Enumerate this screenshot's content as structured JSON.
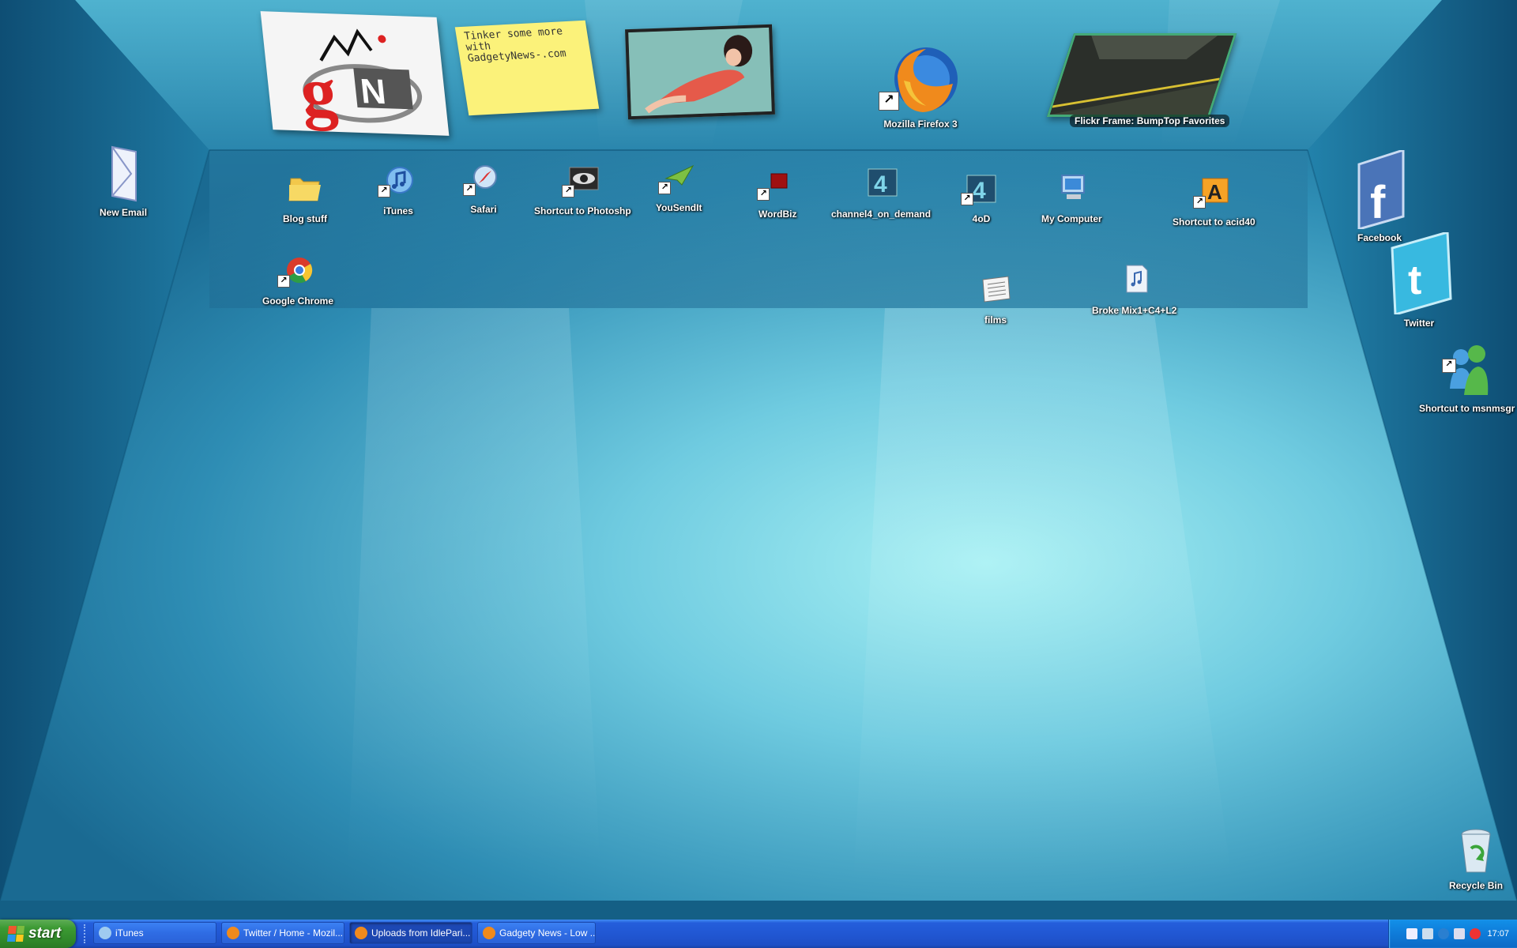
{
  "wall_items": {
    "sticky_note": "Tinker some more with GadgetyNews-.com",
    "firefox_label": "Mozilla Firefox 3",
    "flickr_label": "Flickr Frame: BumpTop Favorites"
  },
  "desktop_icons": {
    "new_email": "New Email",
    "blog_stuff": "Blog stuff",
    "itunes": "iTunes",
    "safari": "Safari",
    "photoshop": "Shortcut to Photoshp",
    "yousendit": "YouSendIt",
    "wordbiz": "WordBiz",
    "channel4": "channel4_on_demand",
    "fourod": "4oD",
    "my_computer": "My Computer",
    "acid40": "Shortcut to acid40",
    "google_chrome": "Google Chrome",
    "films": "films",
    "broke_mix": "Broke Mix1+C4+L2",
    "facebook": "Facebook",
    "twitter": "Twitter",
    "msnmsgr": "Shortcut to msnmsgr",
    "recycle_bin": "Recycle Bin"
  },
  "taskbar": {
    "start_label": "start",
    "tasks": [
      {
        "label": "iTunes"
      },
      {
        "label": "Twitter / Home - Mozil..."
      },
      {
        "label": "Uploads from IdlePari..."
      },
      {
        "label": "Gadgety News - Low ..."
      }
    ],
    "clock": "17:07"
  },
  "colors": {
    "room_dark": "#0d4f73",
    "room_light": "#8fe3ef",
    "taskbar_blue": "#245edb",
    "start_green": "#3c9a33"
  }
}
